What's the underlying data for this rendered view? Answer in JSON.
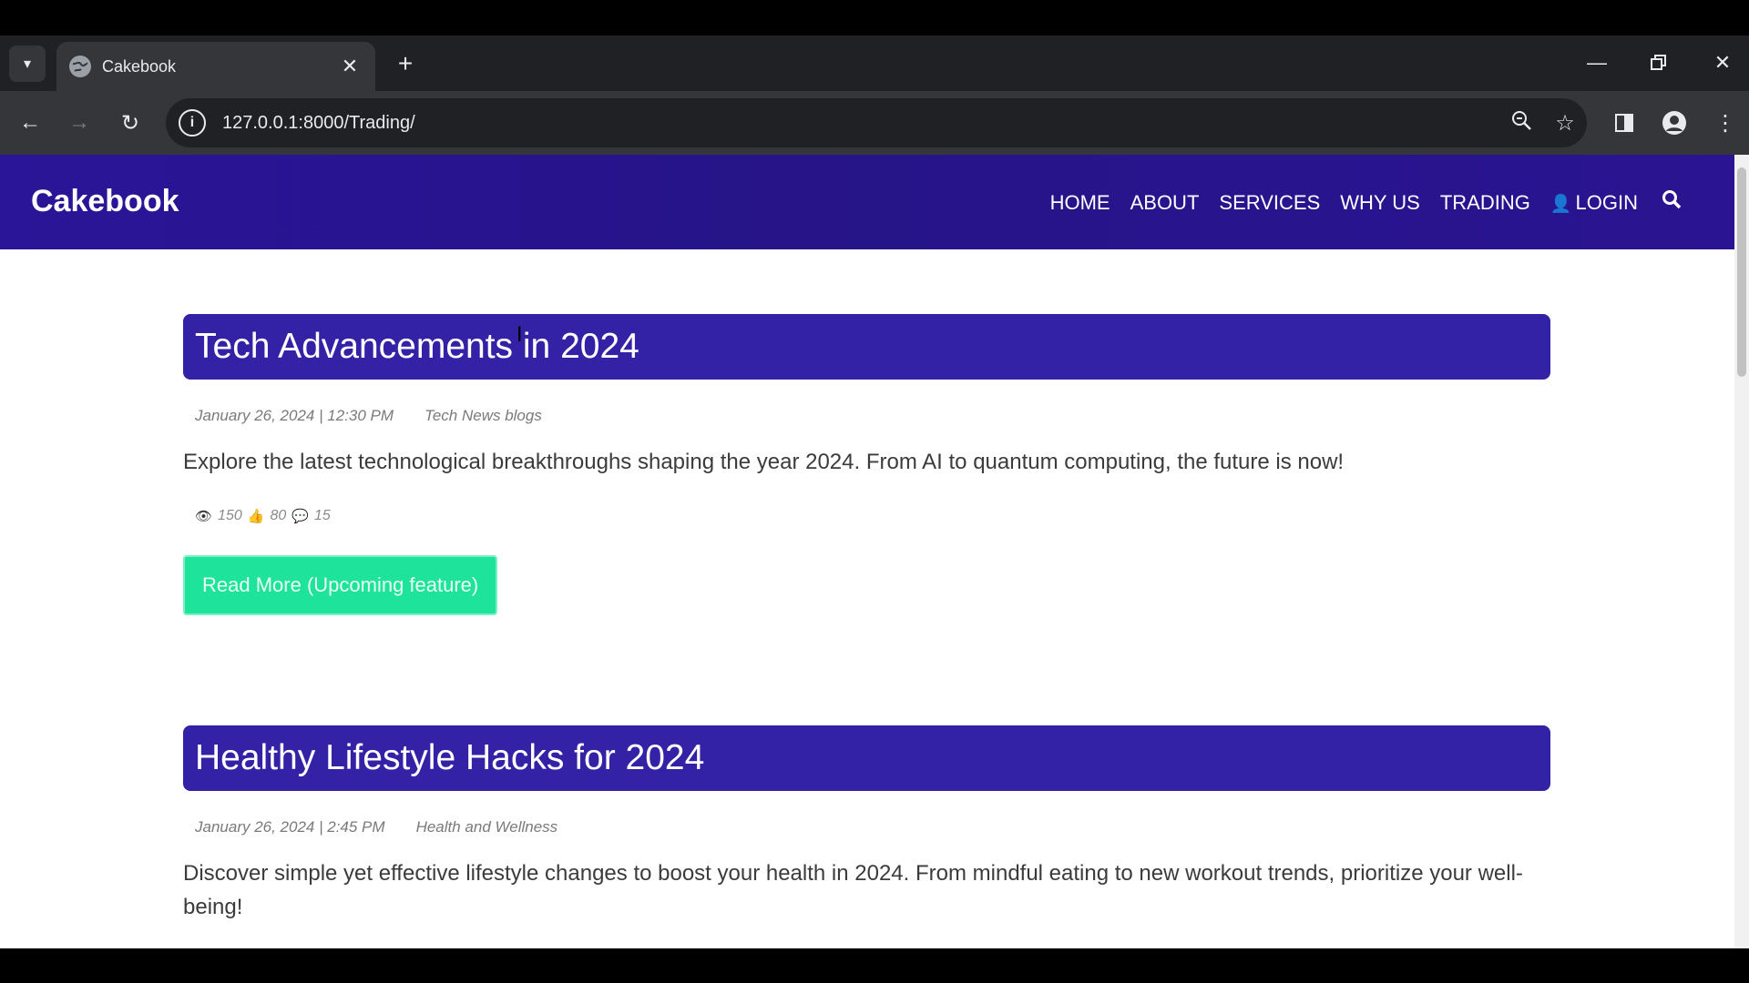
{
  "browser": {
    "tab_title": "Cakebook",
    "url": "127.0.0.1:8000/Trading/"
  },
  "site": {
    "brand": "Cakebook",
    "nav": {
      "home": "HOME",
      "about": "ABOUT",
      "services": "SERVICES",
      "why_us": "WHY US",
      "trading": "TRADING",
      "login": "LOGIN"
    }
  },
  "posts": [
    {
      "title": "Tech Advancements in 2024",
      "date": "January 26, 2024 | 12:30 PM",
      "category": "Tech News blogs",
      "excerpt": "Explore the latest technological breakthroughs shaping the year 2024. From AI to quantum computing, the future is now!",
      "views": "150",
      "likes": "80",
      "comments": "15",
      "button": "Read More (Upcoming feature)"
    },
    {
      "title": "Healthy Lifestyle Hacks for 2024",
      "date": "January 26, 2024 | 2:45 PM",
      "category": "Health and Wellness",
      "excerpt": "Discover simple yet effective lifestyle changes to boost your health in 2024. From mindful eating to new workout trends, prioritize your well-being!"
    }
  ],
  "colors": {
    "header_bg": "#2a1598",
    "title_bar": "#3322a5",
    "button_bg": "#1ee39a"
  }
}
